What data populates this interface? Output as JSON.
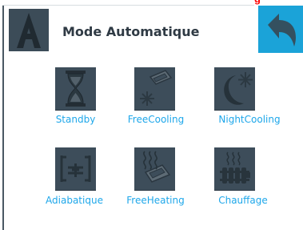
{
  "header": {
    "red_mark": "g",
    "title": "Mode Automatique",
    "mode_icon": "letter-a-icon",
    "back_icon": "back-arrow-icon"
  },
  "modes": [
    {
      "label": "Standby",
      "icon": "hourglass-icon"
    },
    {
      "label": "FreeCooling",
      "icon": "freecooling-icon"
    },
    {
      "label": "NightCooling",
      "icon": "nightcooling-icon"
    },
    {
      "label": "Adiabatique",
      "icon": "adiabatic-icon"
    },
    {
      "label": "FreeHeating",
      "icon": "freeheating-icon"
    },
    {
      "label": "Chauffage",
      "icon": "heating-radiator-icon"
    }
  ],
  "colors": {
    "accent": "#1ba3d8",
    "label": "#1ea7ea",
    "tile": "#3d4d5a",
    "title": "#2f3a44",
    "red_mark": "#ff0000"
  }
}
